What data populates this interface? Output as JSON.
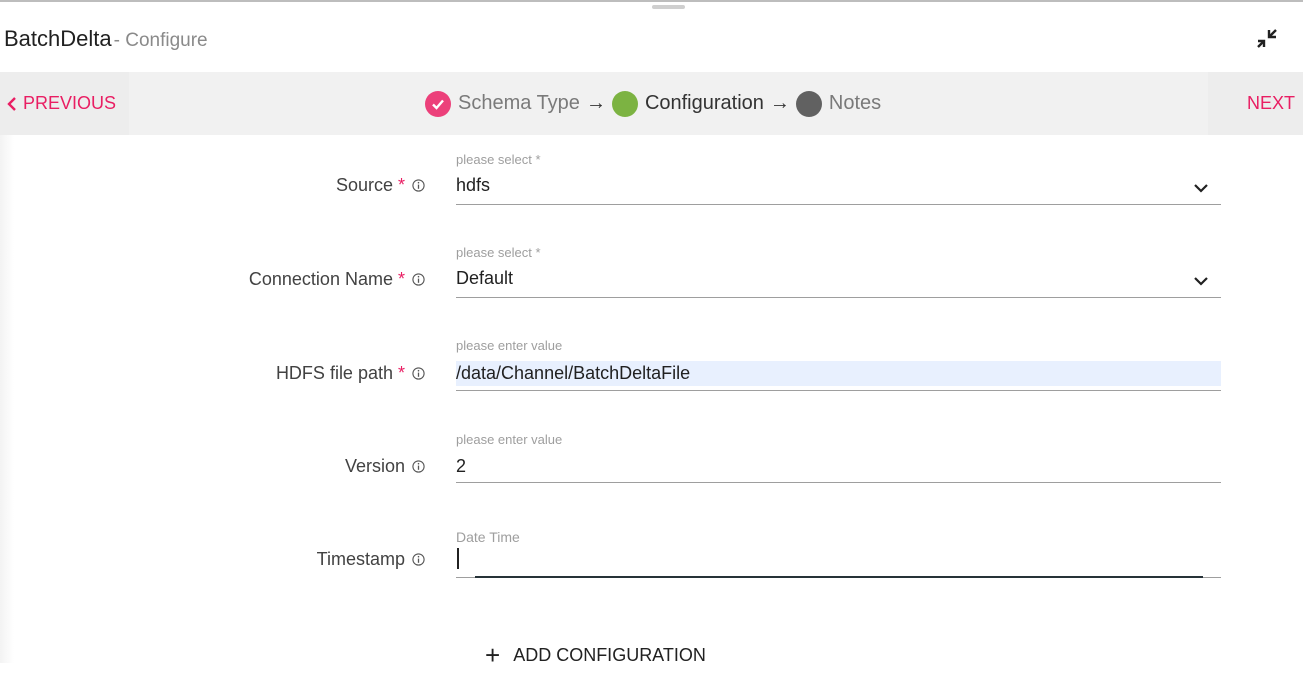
{
  "header": {
    "title": "BatchDelta",
    "subtitle": "- Configure",
    "collapse_icon": "collapse-arrows-icon"
  },
  "stepper": {
    "previous_label": "PREVIOUS",
    "next_label": "NEXT",
    "arrow": "→",
    "steps": [
      {
        "label": "Schema Type",
        "state": "done"
      },
      {
        "label": "Configuration",
        "state": "active"
      },
      {
        "label": "Notes",
        "state": "pending"
      }
    ]
  },
  "colors": {
    "accent": "#e91e63",
    "step_done": "#ec407a",
    "step_active": "#7cb342",
    "step_pending": "#616161"
  },
  "form": {
    "source": {
      "label": "Source",
      "required": "*",
      "hint": "please select *",
      "value": "hdfs"
    },
    "connection_name": {
      "label": "Connection Name",
      "required": "*",
      "hint": "please select *",
      "value": "Default"
    },
    "hdfs_file_path": {
      "label": "HDFS file path",
      "required": "*",
      "hint": "please enter value",
      "value": "/data/Channel/BatchDeltaFile"
    },
    "version": {
      "label": "Version",
      "hint": "please enter value",
      "value": "2"
    },
    "timestamp": {
      "label": "Timestamp",
      "hint": "Date Time",
      "value": ""
    }
  },
  "actions": {
    "add_configuration_label": "ADD CONFIGURATION"
  }
}
